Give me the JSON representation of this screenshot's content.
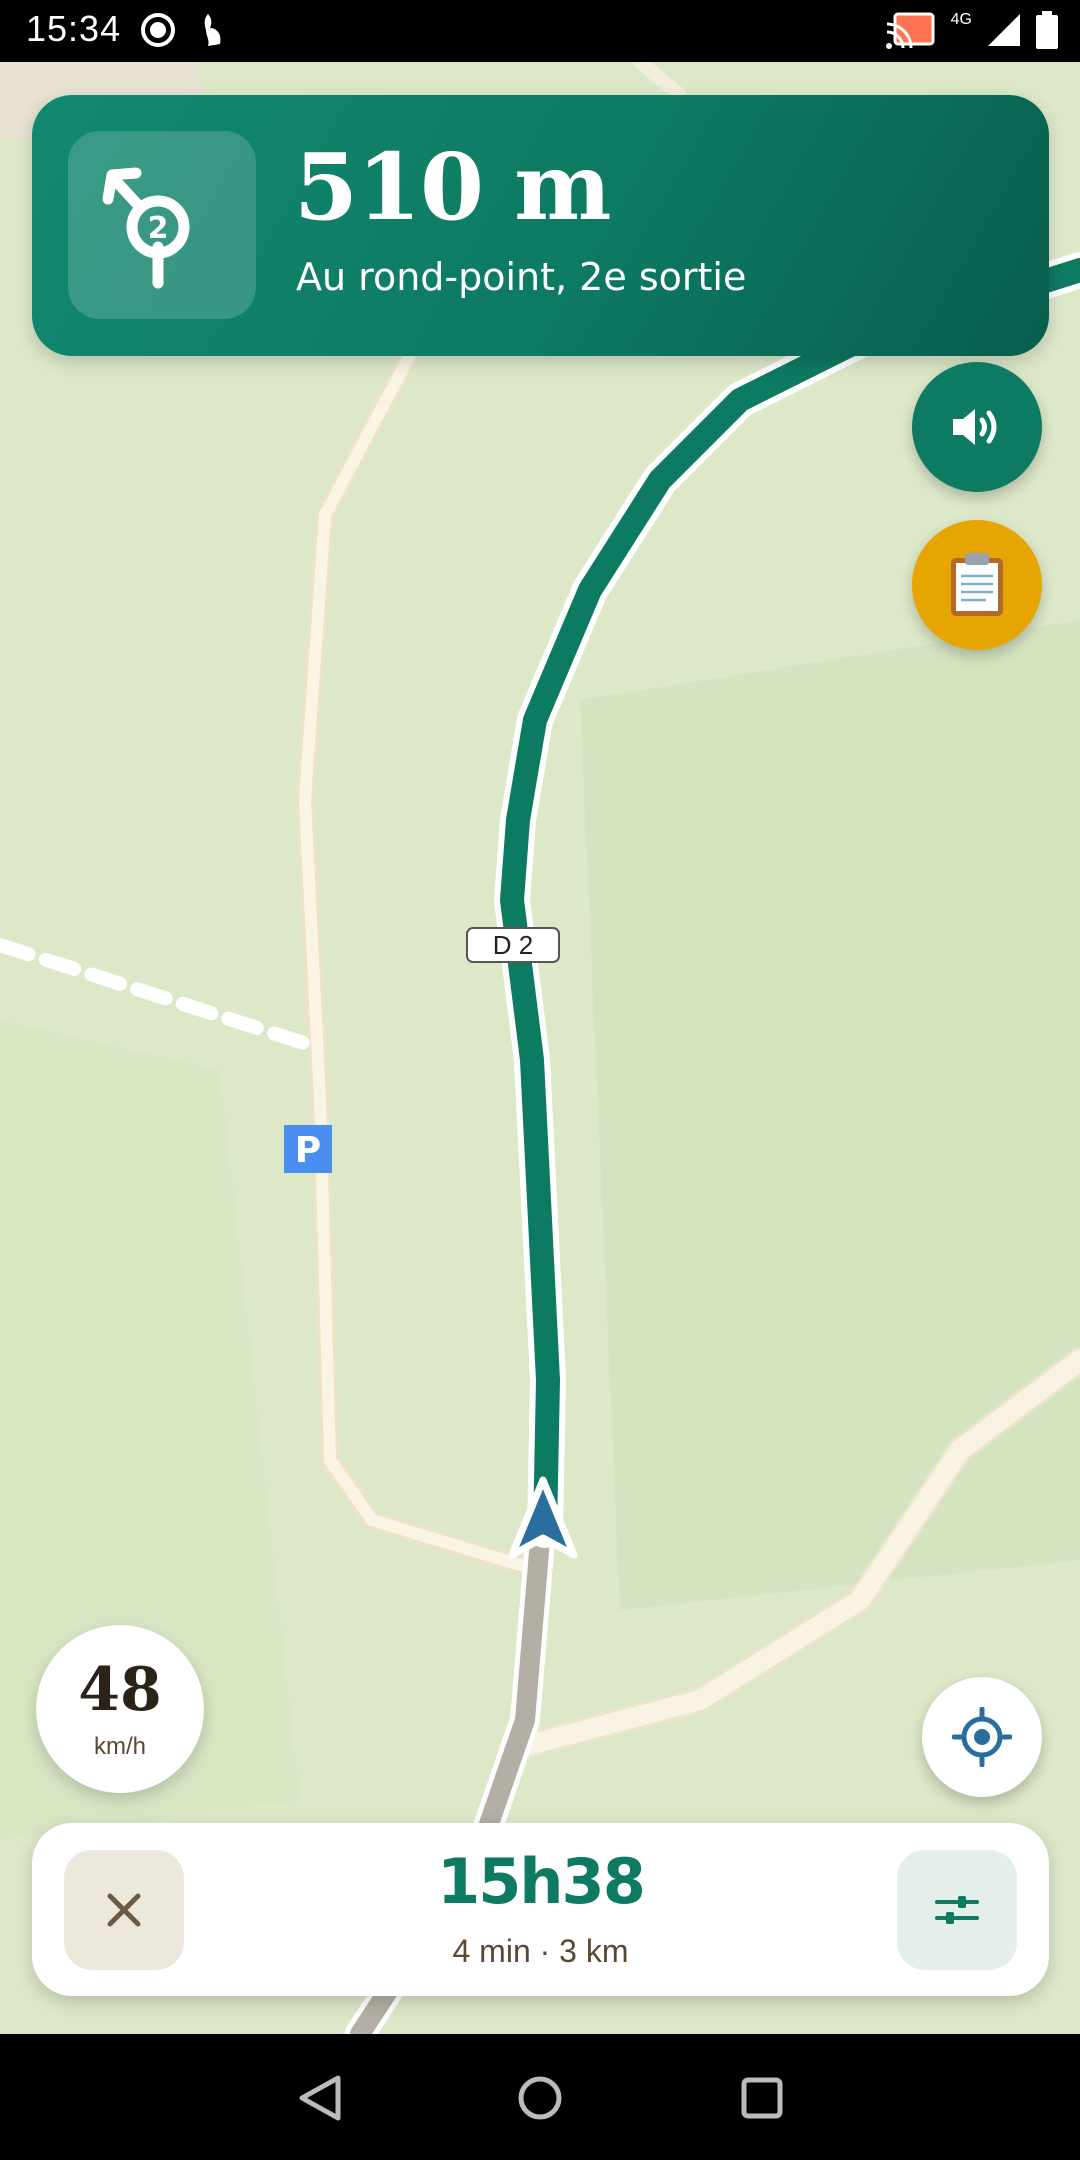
{
  "status_bar": {
    "time": "15:34",
    "network": "4G",
    "icons": [
      "record-icon",
      "rabbit-icon",
      "cast-icon",
      "signal-icon",
      "battery-icon"
    ]
  },
  "navigation": {
    "distance": "510 m",
    "instruction": "Au rond-point, 2e sortie",
    "maneuver_icon": "roundabout-exit-2-icon",
    "exit_number": "2"
  },
  "map": {
    "road_label": "D  2",
    "parking_label": "P",
    "route_color": "#0d7a62",
    "position_marker_color": "#2a6ea0"
  },
  "speed": {
    "value": "48",
    "unit": "km/h"
  },
  "trip": {
    "arrival_time": "15h38",
    "summary": "4 min · 3 km"
  },
  "fabs": {
    "sound": "speaker-icon",
    "report": "clipboard-icon",
    "locate": "locate-icon"
  },
  "colors": {
    "brand_green": "#0d7a62",
    "report_yellow": "#e6a500",
    "map_background": "#dde8c9"
  }
}
